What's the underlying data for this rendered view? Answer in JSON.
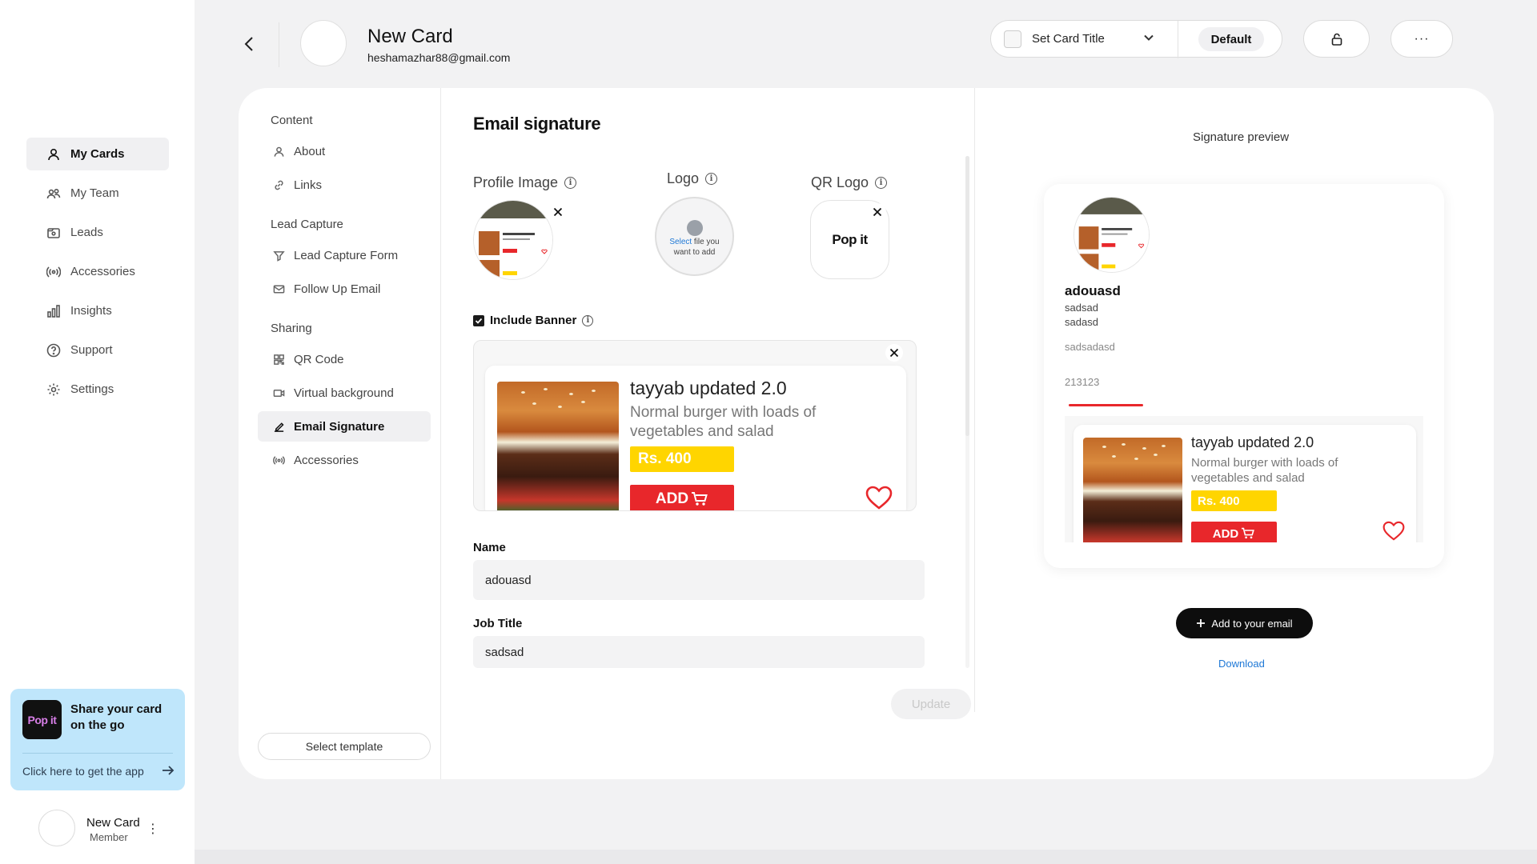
{
  "sidebar": {
    "nav": [
      {
        "label": "My Cards",
        "icon": "user-icon",
        "active": true
      },
      {
        "label": "My Team",
        "icon": "team-icon"
      },
      {
        "label": "Leads",
        "icon": "leads-icon"
      },
      {
        "label": "Accessories",
        "icon": "broadcast-icon"
      },
      {
        "label": "Insights",
        "icon": "bar-chart-icon"
      },
      {
        "label": "Support",
        "icon": "help-icon"
      },
      {
        "label": "Settings",
        "icon": "gear-icon"
      }
    ],
    "promo": {
      "logo_text": "Pop it",
      "title": "Share your card on the go",
      "link": "Click here to get the app"
    },
    "user": {
      "name": "New Card",
      "role": "Member"
    }
  },
  "header": {
    "title": "New Card",
    "email": "heshamazhar88@gmail.com",
    "card_title_select": "Set Card Title",
    "default_label": "Default"
  },
  "menu": {
    "sections": {
      "content": "Content",
      "lead_capture": "Lead Capture",
      "sharing": "Sharing"
    },
    "items": {
      "about": "About",
      "links": "Links",
      "lead_capture_form": "Lead Capture Form",
      "follow_up_email": "Follow Up Email",
      "qr_code": "QR Code",
      "virtual_background": "Virtual background",
      "email_signature": "Email Signature",
      "accessories": "Accessories"
    },
    "select_template": "Select template"
  },
  "editor": {
    "title": "Email signature",
    "profile_image_label": "Profile Image",
    "logo_label": "Logo",
    "qr_logo_label": "QR Logo",
    "upload_select": "Select",
    "upload_rest": " file you want to add",
    "qr_logo_text": "Pop it",
    "include_banner": "Include Banner",
    "include_banner_checked": true,
    "name_label": "Name",
    "name_value": "adouasd",
    "job_title_label": "Job Title",
    "job_title_value": "sadsad",
    "update_button": "Update"
  },
  "banner": {
    "title": "tayyab updated 2.0",
    "desc": "Normal burger with loads of vegetables and salad",
    "price": "Rs. 400",
    "add": "ADD"
  },
  "preview": {
    "label": "Signature preview",
    "name": "adouasd",
    "line1": "sadsad",
    "line2": "sadasd",
    "line3": "sadsadasd",
    "line4": "213123",
    "add_button": "Add to your email",
    "download": "Download"
  },
  "colors": {
    "accent_red": "#e8272b",
    "price_yellow": "#ffd500",
    "promo_bg": "#bfe6fb",
    "link_blue": "#1e78d6"
  }
}
